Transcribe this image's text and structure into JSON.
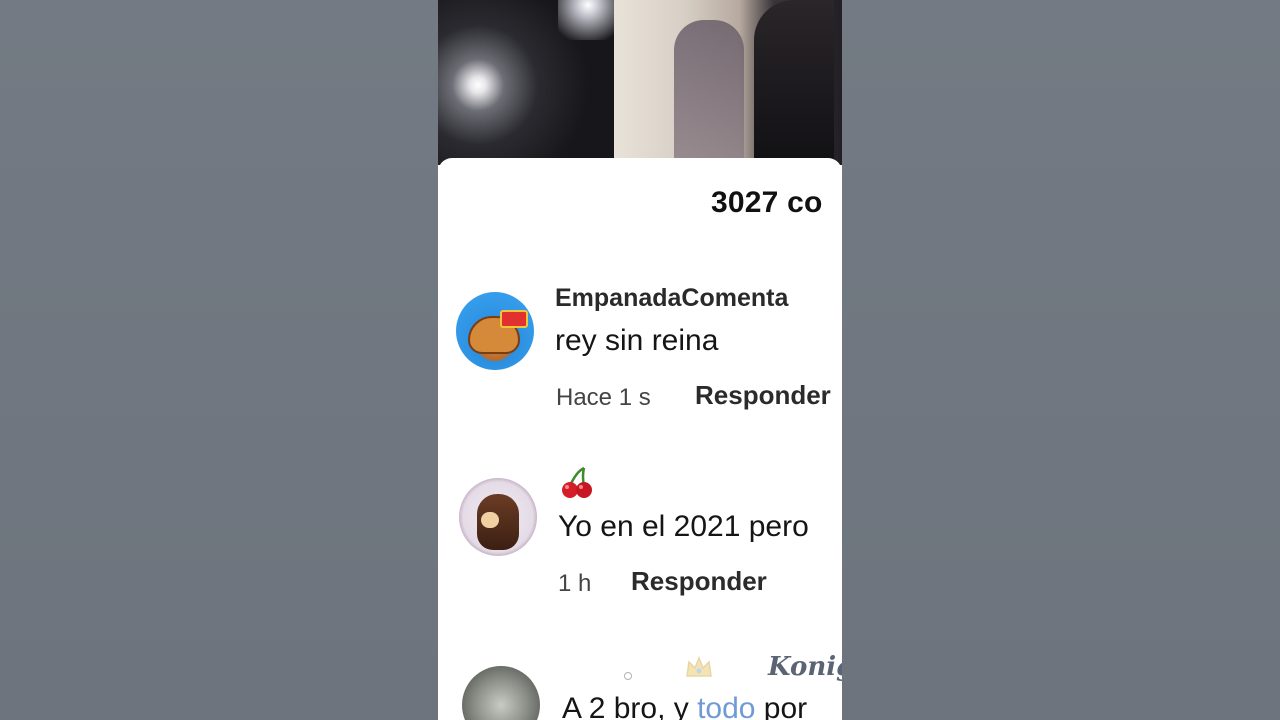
{
  "sheet": {
    "title": "3027 co"
  },
  "comments": [
    {
      "username": "EmpanadaComenta",
      "text": "rey sin reina",
      "time": "Hace 1 s",
      "reply_label": "Responder",
      "avatar_icon": "empanada-avatar"
    },
    {
      "username_icon": "cherry-icon",
      "text": "Yo en el 2021 pero",
      "time": "1 h",
      "reply_label": "Responder",
      "avatar_icon": "deer-avatar"
    },
    {
      "username_icon": "crown-icon",
      "username_tail": "Konig",
      "text_start": "A 2 bro, y ",
      "text_link": "todo",
      "text_end": " por",
      "avatar_icon": "photo-avatar"
    }
  ]
}
